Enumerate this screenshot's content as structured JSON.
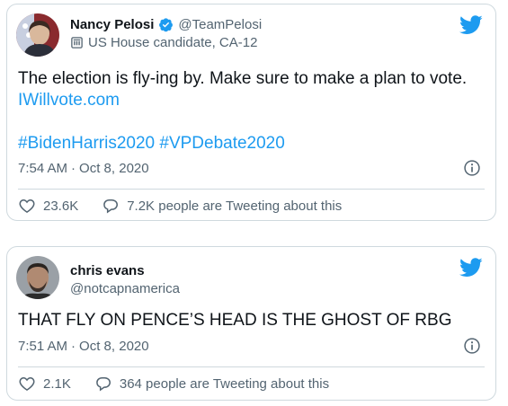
{
  "tweets": [
    {
      "display_name": "Nancy Pelosi",
      "handle": "@TeamPelosi",
      "verified": true,
      "label": "US House candidate, CA-12",
      "text_line1": "The election is fly-ing by. Make sure to make a plan to vote.",
      "text_link": "IWillvote.com",
      "hashtags": "#BidenHarris2020 #VPDebate2020",
      "time": "7:54 AM",
      "date": "Oct 8, 2020",
      "likes": "23.6K",
      "tweeting": "7.2K people are Tweeting about this"
    },
    {
      "display_name": "chris evans",
      "handle": "@notcapnamerica",
      "text": "THAT FLY ON PENCE’S HEAD IS THE GHOST OF RBG",
      "time": "7:51 AM",
      "date": "Oct 8, 2020",
      "likes": "2.1K",
      "tweeting": "364 people are Tweeting about this"
    }
  ],
  "colors": {
    "accent": "#1d9bf0",
    "text": "#0f1419",
    "muted": "#536471",
    "border": "#cfd9de"
  },
  "icons": {
    "logo": "twitter-bird-icon",
    "verified": "verified-badge-icon",
    "label": "government-building-icon",
    "info": "info-icon",
    "like": "heart-icon",
    "reply": "speech-bubble-icon"
  }
}
